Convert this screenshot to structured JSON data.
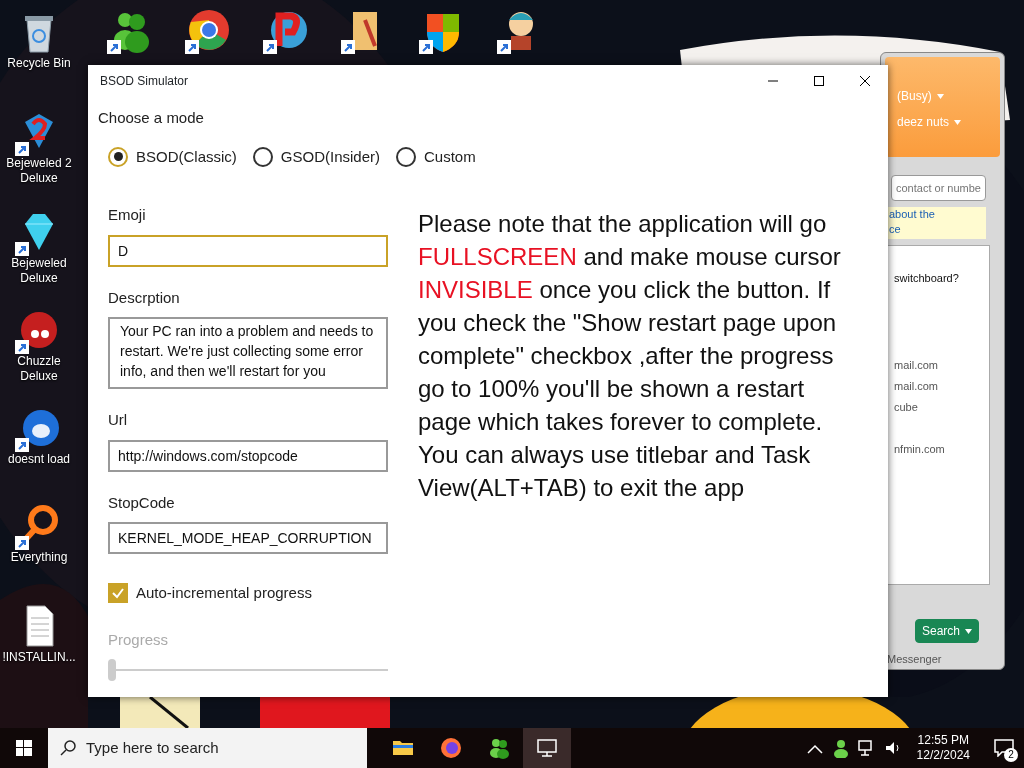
{
  "desktop_icons": [
    {
      "label": "Recycle Bin",
      "kind": "bin"
    },
    {
      "label": "Bejeweled 2 Deluxe",
      "kind": "gem2"
    },
    {
      "label": "Bejeweled Deluxe",
      "kind": "gem"
    },
    {
      "label": "Chuzzle Deluxe",
      "kind": "fuzz"
    },
    {
      "label": "doesnt load",
      "kind": "bird"
    },
    {
      "label": "Everything",
      "kind": "lens"
    },
    {
      "label": "!INSTALLIN...",
      "kind": "doc"
    }
  ],
  "messenger": {
    "status": "(Busy)",
    "message": "deez nuts",
    "search_placeholder": "contact or numbe",
    "banner": [
      "about the",
      "ce"
    ],
    "rows": [
      "switchboard?",
      "mail.com",
      "mail.com",
      "cube",
      "nfmin.com"
    ],
    "search_button": "Search",
    "footer": "Messenger"
  },
  "window": {
    "title": "BSOD Simulator",
    "mode_label": "Choose a mode",
    "modes": [
      {
        "label": "BSOD(Classic)",
        "selected": true
      },
      {
        "label": "GSOD(Insider)",
        "selected": false
      },
      {
        "label": "Custom",
        "selected": false
      }
    ],
    "fields": [
      {
        "label": "Emoji",
        "value": "D",
        "kind": "input",
        "focused": true
      },
      {
        "label": "Descrption",
        "value": "Your PC ran into a problem and needs to restart. We're just collecting some error info, and then we'll restart for you",
        "kind": "textarea",
        "focused": false
      },
      {
        "label": "Url",
        "value": "http://windows.com/stopcode",
        "kind": "input",
        "focused": false
      },
      {
        "label": "StopCode",
        "value": "KERNEL_MODE_HEAP_CORRUPTION",
        "kind": "input",
        "focused": false
      }
    ],
    "checkbox": {
      "label": "Auto-incremental progress",
      "checked": true
    },
    "progress": {
      "label": "Progress",
      "disabled": true,
      "level": 0
    },
    "notice": [
      {
        "text": "Please note that the application will go ",
        "emphasis": false
      },
      {
        "text": "FULLSCREEN",
        "emphasis": true
      },
      {
        "text": " and make mouse cursor ",
        "emphasis": false
      },
      {
        "text": "INVISIBLE",
        "emphasis": true
      },
      {
        "text": " once you click the button. If you check the \"Show restart page upon complete\" checkbox ,after the progress go to 100% you'll be shown a restart page which takes forever to complete. You can always use titlebar and Task View(ALT+TAB) to exit the app",
        "emphasis": false
      }
    ]
  },
  "taskbar": {
    "search_placeholder": "Type here to search",
    "time": "12:55 PM",
    "date": "12/2/2024",
    "notification_count": "2"
  }
}
